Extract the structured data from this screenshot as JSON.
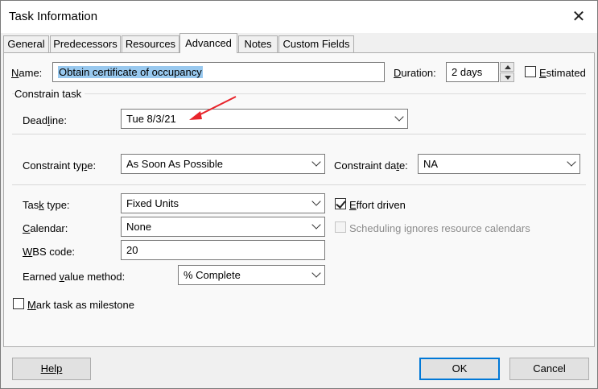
{
  "dialog": {
    "title": "Task Information"
  },
  "tabs": [
    {
      "label": "General",
      "active": false
    },
    {
      "label": "Predecessors",
      "active": false
    },
    {
      "label": "Resources",
      "active": false
    },
    {
      "label": "Advanced",
      "active": true
    },
    {
      "label": "Notes",
      "active": false
    },
    {
      "label": "Custom Fields",
      "active": false
    }
  ],
  "name": {
    "label_pre": "N",
    "label_rest": "ame:",
    "value": "Obtain certificate of occupancy"
  },
  "duration": {
    "label_pre": "D",
    "label_rest": "uration:",
    "value": "2 days"
  },
  "estimated": {
    "label_pre": "E",
    "label_rest": "stimated",
    "checked": false
  },
  "constrain_group": {
    "label": "Constrain task"
  },
  "deadline": {
    "label": "Dead",
    "label_u": "l",
    "label_rest": "ine:",
    "value": "Tue 8/3/21"
  },
  "constraint_type": {
    "label": "Constraint ty",
    "label_u": "p",
    "label_rest": "e:",
    "value": "As Soon As Possible"
  },
  "constraint_date": {
    "label": "Constraint da",
    "label_u": "t",
    "label_rest": "e:",
    "value": "NA"
  },
  "task_type": {
    "label": "Tas",
    "label_u": "k",
    "label_rest": " type:",
    "value": "Fixed Units"
  },
  "calendar": {
    "label_u": "C",
    "label_rest": "alendar:",
    "value": "None"
  },
  "wbs": {
    "label_u": "W",
    "label_rest": "BS code:",
    "value": "20"
  },
  "earned_value": {
    "label": "Earned ",
    "label_u": "v",
    "label_rest": "alue method:",
    "value": "% Complete"
  },
  "effort_driven": {
    "label_u": "E",
    "label_rest": "ffort driven",
    "checked": true
  },
  "scheduling_ignores": {
    "label": "Scheduling ignores resource calendars",
    "checked": false,
    "disabled": true
  },
  "milestone": {
    "label_u": "M",
    "label_rest": "ark task as milestone",
    "checked": false
  },
  "buttons": {
    "help": "Help",
    "ok": "OK",
    "cancel": "Cancel"
  },
  "colors": {
    "annotation_arrow": "#e8242b",
    "selection": "#99c9ef",
    "focus": "#0078d7"
  }
}
